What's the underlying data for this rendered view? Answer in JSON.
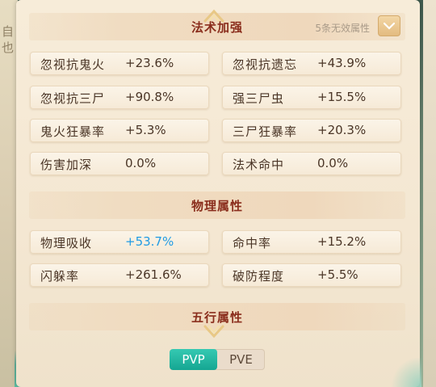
{
  "sections": {
    "magic": {
      "title": "法术加强",
      "invalid_note": "5条无效属性"
    },
    "physical": {
      "title": "物理属性"
    },
    "elements": {
      "title": "五行属性"
    }
  },
  "side_glyphs": [
    "自",
    "也"
  ],
  "magic_attrs": [
    {
      "name": "忽视抗鬼火",
      "value": "+23.6%"
    },
    {
      "name": "忽视抗遗忘",
      "value": "+43.9%"
    },
    {
      "name": "忽视抗三尸",
      "value": "+90.8%"
    },
    {
      "name": "强三尸虫",
      "value": "+15.5%"
    },
    {
      "name": "鬼火狂暴率",
      "value": "+5.3%"
    },
    {
      "name": "三尸狂暴率",
      "value": "+20.3%"
    },
    {
      "name": "伤害加深",
      "value": "0.0%"
    },
    {
      "name": "法术命中",
      "value": "0.0%"
    }
  ],
  "physical_attrs": [
    {
      "name": "物理吸收",
      "value": "+53.7%",
      "highlight": true
    },
    {
      "name": "命中率",
      "value": "+15.2%"
    },
    {
      "name": "闪躲率",
      "value": "+261.6%"
    },
    {
      "name": "破防程度",
      "value": "+5.5%"
    }
  ],
  "tabs": [
    {
      "label": "PVP",
      "active": true
    },
    {
      "label": "PVE",
      "active": false
    }
  ],
  "colors": {
    "title_red": "#8a2d1c",
    "value_blue": "#1f9be4",
    "tab_teal": "#1db39e"
  }
}
